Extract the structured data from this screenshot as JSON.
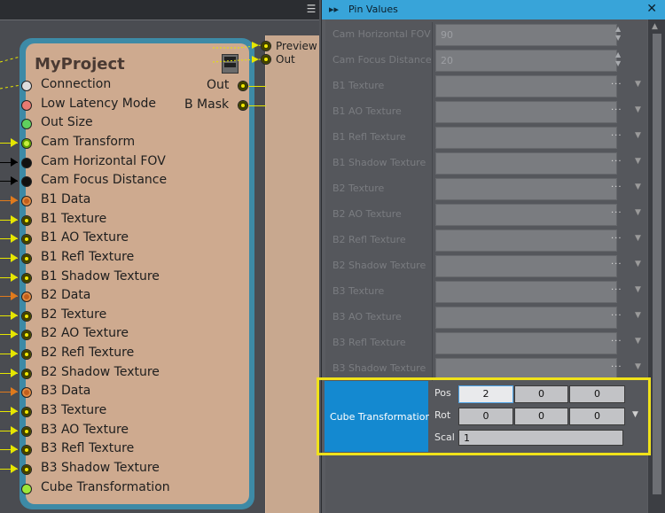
{
  "left_pane": {
    "menu_icon": "hamburger-icon",
    "node": {
      "title": "MyProject",
      "menu_icon": "node-menu-icon",
      "inputs": [
        {
          "label": "Connection",
          "color": "#dcdcdc"
        },
        {
          "label": "Low Latency Mode",
          "color": "#e67a72"
        },
        {
          "label": "Out Size",
          "color": "#5fd05e"
        },
        {
          "label": "Cam Transform",
          "color": "#c8f03c"
        },
        {
          "label": "Cam Horizontal FOV",
          "color": "#111111"
        },
        {
          "label": "Cam Focus Distance",
          "color": "#111111"
        },
        {
          "label": "B1 Data",
          "color": "#c25e1c"
        },
        {
          "label": "B1 Texture",
          "color": "#f0e800"
        },
        {
          "label": "B1 AO Texture",
          "color": "#f0e800"
        },
        {
          "label": "B1 Refl Texture",
          "color": "#f0e800"
        },
        {
          "label": "B1 Shadow Texture",
          "color": "#f0e800"
        },
        {
          "label": "B2 Data",
          "color": "#c25e1c"
        },
        {
          "label": "B2 Texture",
          "color": "#f0e800"
        },
        {
          "label": "B2 AO Texture",
          "color": "#f0e800"
        },
        {
          "label": "B2 Refl Texture",
          "color": "#f0e800"
        },
        {
          "label": "B2 Shadow Texture",
          "color": "#f0e800"
        },
        {
          "label": "B3 Data",
          "color": "#c25e1c"
        },
        {
          "label": "B3 Texture",
          "color": "#f0e800"
        },
        {
          "label": "B3 AO Texture",
          "color": "#f0e800"
        },
        {
          "label": "B3 Refl Texture",
          "color": "#f0e800"
        },
        {
          "label": "B3 Shadow Texture",
          "color": "#f0e800"
        },
        {
          "label": "Cube Transformation",
          "color": "#9be83a"
        }
      ],
      "outputs": [
        {
          "label": "Out"
        },
        {
          "label": "B Mask"
        }
      ]
    },
    "downstream": {
      "preview_label": "Preview",
      "out_label": "Out"
    }
  },
  "pin_values": {
    "title": "Pin Values",
    "header_icon": "double-arrow-icon",
    "close_icon": "close-icon",
    "rows": [
      {
        "label": "Cam Horizontal FOV",
        "value": "90",
        "kind": "spin"
      },
      {
        "label": "Cam Focus Distance",
        "value": "20",
        "kind": "spin"
      },
      {
        "label": "B1 Texture",
        "value": "",
        "kind": "file"
      },
      {
        "label": "B1 AO Texture",
        "value": "",
        "kind": "file"
      },
      {
        "label": "B1 Refl Texture",
        "value": "",
        "kind": "file"
      },
      {
        "label": "B1 Shadow Texture",
        "value": "",
        "kind": "file"
      },
      {
        "label": "B2 Texture",
        "value": "",
        "kind": "file"
      },
      {
        "label": "B2 AO Texture",
        "value": "",
        "kind": "file"
      },
      {
        "label": "B2 Refl Texture",
        "value": "",
        "kind": "file"
      },
      {
        "label": "B2 Shadow Texture",
        "value": "",
        "kind": "file"
      },
      {
        "label": "B3 Texture",
        "value": "",
        "kind": "file"
      },
      {
        "label": "B3 AO Texture",
        "value": "",
        "kind": "file"
      },
      {
        "label": "B3 Refl Texture",
        "value": "",
        "kind": "file"
      },
      {
        "label": "B3 Shadow Texture",
        "value": "",
        "kind": "file"
      }
    ],
    "file_button_text": "···",
    "cube": {
      "label": "Cube Transformation",
      "pos_label": "Pos",
      "rot_label": "Rot",
      "scal_label": "Scal",
      "pos": [
        "2",
        "0",
        "0"
      ],
      "rot": [
        "0",
        "0",
        "0"
      ],
      "scal": "1",
      "highlight_color": "#f0e21a",
      "label_bg": "#1489d0"
    }
  },
  "colors": {
    "accent": "#38a4d9",
    "node_bg": "#ceaa8f",
    "node_glow": "#3d8aa6",
    "wire": "#e6e600"
  }
}
